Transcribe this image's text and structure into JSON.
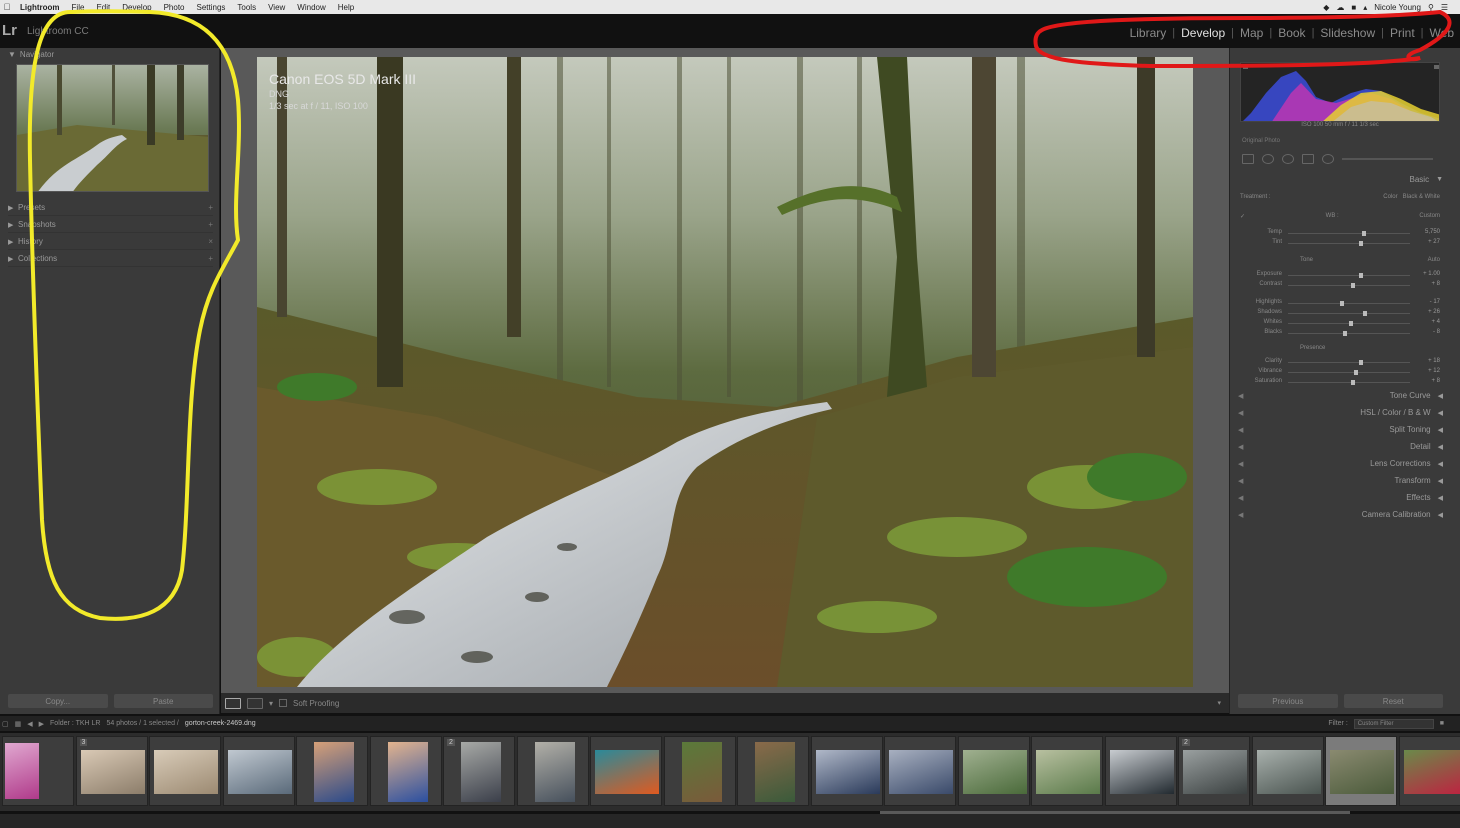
{
  "menubar": {
    "apple_icon": "apple-icon",
    "items": [
      "Lightroom",
      "File",
      "Edit",
      "Develop",
      "Photo",
      "Settings",
      "Tools",
      "View",
      "Window",
      "Help"
    ],
    "user": "Nicole Young"
  },
  "identity": {
    "logo": "Lr",
    "app_name": "Lightroom CC"
  },
  "modules": {
    "items": [
      "Library",
      "Develop",
      "Map",
      "Book",
      "Slideshow",
      "Print",
      "Web"
    ],
    "active": "Develop"
  },
  "left_panel": {
    "header": "Navigator",
    "sections": [
      "Presets",
      "Snapshots",
      "History",
      "Collections"
    ],
    "copy_button": "Copy...",
    "paste_button": "Paste"
  },
  "photo": {
    "camera": "Canon EOS 5D Mark III",
    "format": "DNG",
    "exposure": "1/3 sec at f / 11, ISO 100"
  },
  "toolbar": {
    "soft_proofing": "Soft Proofing"
  },
  "right_panel": {
    "histogram_values": "ISO 100   50 mm   f / 11   1/3 sec",
    "original_photo": "Original Photo",
    "basic": {
      "title": "Basic",
      "treatment_label": "Treatment :",
      "treatment_color": "Color",
      "treatment_bw": "Black & White",
      "wb_label": "WB :",
      "wb_value": "Custom",
      "tone_label": "Tone",
      "tone_auto": "Auto",
      "presence_label": "Presence",
      "sliders": [
        {
          "label": "Temp",
          "value": "5,750",
          "pos": 0.62
        },
        {
          "label": "Tint",
          "value": "+ 27",
          "pos": 0.6
        },
        {
          "label": "Exposure",
          "value": "+ 1.00",
          "pos": 0.6
        },
        {
          "label": "Contrast",
          "value": "+ 8",
          "pos": 0.53
        },
        {
          "label": "Highlights",
          "value": "- 17",
          "pos": 0.44
        },
        {
          "label": "Shadows",
          "value": "+ 26",
          "pos": 0.63
        },
        {
          "label": "Whites",
          "value": "+ 4",
          "pos": 0.52
        },
        {
          "label": "Blacks",
          "value": "- 8",
          "pos": 0.47
        },
        {
          "label": "Clarity",
          "value": "+ 18",
          "pos": 0.6
        },
        {
          "label": "Vibrance",
          "value": "+ 12",
          "pos": 0.56
        },
        {
          "label": "Saturation",
          "value": "+ 8",
          "pos": 0.53
        }
      ]
    },
    "sections": [
      "Tone Curve",
      "HSL / Color / B & W",
      "Split Toning",
      "Detail",
      "Lens Corrections",
      "Transform",
      "Effects",
      "Camera Calibration"
    ],
    "previous_button": "Previous",
    "reset_button": "Reset"
  },
  "filmstrip": {
    "folder": "Folder : TKH LR",
    "count": "54 photos / 1 selected /",
    "selected_file": "gorton-creek-2469.dng",
    "filter_label": "Filter :",
    "filter_value": "Custom Filter",
    "thumbs": [
      {
        "colors": [
          "#b03a8a",
          "#e0a8d0"
        ],
        "label": ""
      },
      {
        "colors": [
          "#8c7d6a",
          "#d9c9b5"
        ],
        "label": "3"
      },
      {
        "colors": [
          "#9c8a72",
          "#d8cbb8"
        ],
        "label": ""
      },
      {
        "colors": [
          "#5a6a7a",
          "#c0c8d0"
        ],
        "label": ""
      },
      {
        "colors": [
          "#2b4a8a",
          "#d6a078"
        ],
        "label": ""
      },
      {
        "colors": [
          "#2b4fa0",
          "#e3b48e"
        ],
        "label": ""
      },
      {
        "colors": [
          "#3b3f4a",
          "#a7a9a6"
        ],
        "label": "2"
      },
      {
        "colors": [
          "#46505c",
          "#b2b0a8"
        ],
        "label": ""
      },
      {
        "colors": [
          "#e05a20",
          "#2a8a9a"
        ],
        "label": ""
      },
      {
        "colors": [
          "#7a5a3a",
          "#5a7a3a"
        ],
        "label": ""
      },
      {
        "colors": [
          "#3a5a3a",
          "#8a6a4a"
        ],
        "label": ""
      },
      {
        "colors": [
          "#2a3a5a",
          "#b0b8c8"
        ],
        "label": ""
      },
      {
        "colors": [
          "#3a4a6a",
          "#a8b0c0"
        ],
        "label": ""
      },
      {
        "colors": [
          "#4a6a3a",
          "#a0b090"
        ],
        "label": ""
      },
      {
        "colors": [
          "#5a7a4a",
          "#b8c0a0"
        ],
        "label": ""
      },
      {
        "colors": [
          "#222a30",
          "#c8ccd0"
        ],
        "label": ""
      },
      {
        "colors": [
          "#3a4040",
          "#9aa0a0"
        ],
        "label": "2"
      },
      {
        "colors": [
          "#4a5450",
          "#a8b0ac"
        ],
        "label": ""
      },
      {
        "colors": [
          "#4a5a3a",
          "#8a8a70"
        ],
        "label": ""
      },
      {
        "colors": [
          "#c02040",
          "#6a8a4a"
        ],
        "label": ""
      }
    ],
    "active_index": 18
  },
  "annotations": {
    "yellow": "#f2ea2a",
    "red": "#e01818"
  }
}
